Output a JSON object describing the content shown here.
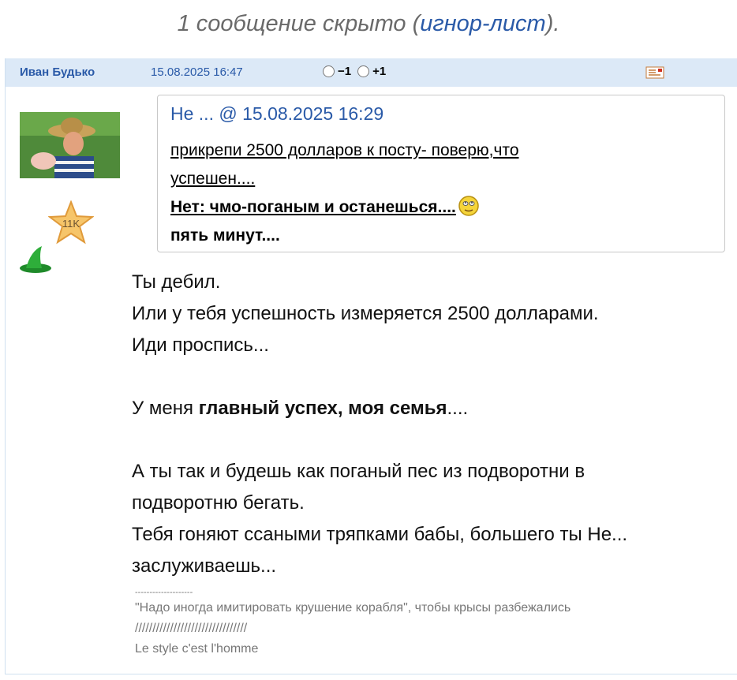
{
  "notice": {
    "prefix": "1 сообщение скрыто (",
    "link": "игнор-лист",
    "suffix": ")."
  },
  "post": {
    "author": "Иван Будько",
    "date": "15.08.2025 16:47",
    "rating": {
      "minus": "−1",
      "plus": "+1"
    },
    "badge": "11K",
    "quote": {
      "header": "Не ... @ 15.08.2025 16:29",
      "line1": "прикрепи 2500 долларов к посту- поверю,что",
      "line2": "успешен....",
      "line3": "Нет: чмо-поганым и останешься....",
      "line4": "пять минут...."
    },
    "body": {
      "l1": "Ты дебил.",
      "l2": "Или у тебя успешность измеряется 2500 долларами.",
      "l3": "Иди проспись...",
      "l4_pre": "У меня ",
      "l4_bold": "главный успех, моя семья",
      "l4_post": "....",
      "l5": "А ты так и будешь как поганый пес из подворотни в",
      "l6": "подворотню бегать.",
      "l7": "Тебя гоняют ссаными тряпками бабы, большего ты Не...",
      "l8": "заслуживаешь..."
    },
    "signature": {
      "sep1": "--------------------",
      "quote": "\"Надо иногда имитировать крушение корабля\", чтобы крысы разбежались",
      "sep2": "////////////////////////////////",
      "motto": "Le style c'est l'homme"
    }
  },
  "colors": {
    "link": "#2a5aa8",
    "header_bg": "#dce9f7",
    "notice": "#6a6a6a"
  },
  "icons": [
    "message-icon",
    "star-badge-icon",
    "wizard-hat-icon",
    "smiley-icon"
  ]
}
